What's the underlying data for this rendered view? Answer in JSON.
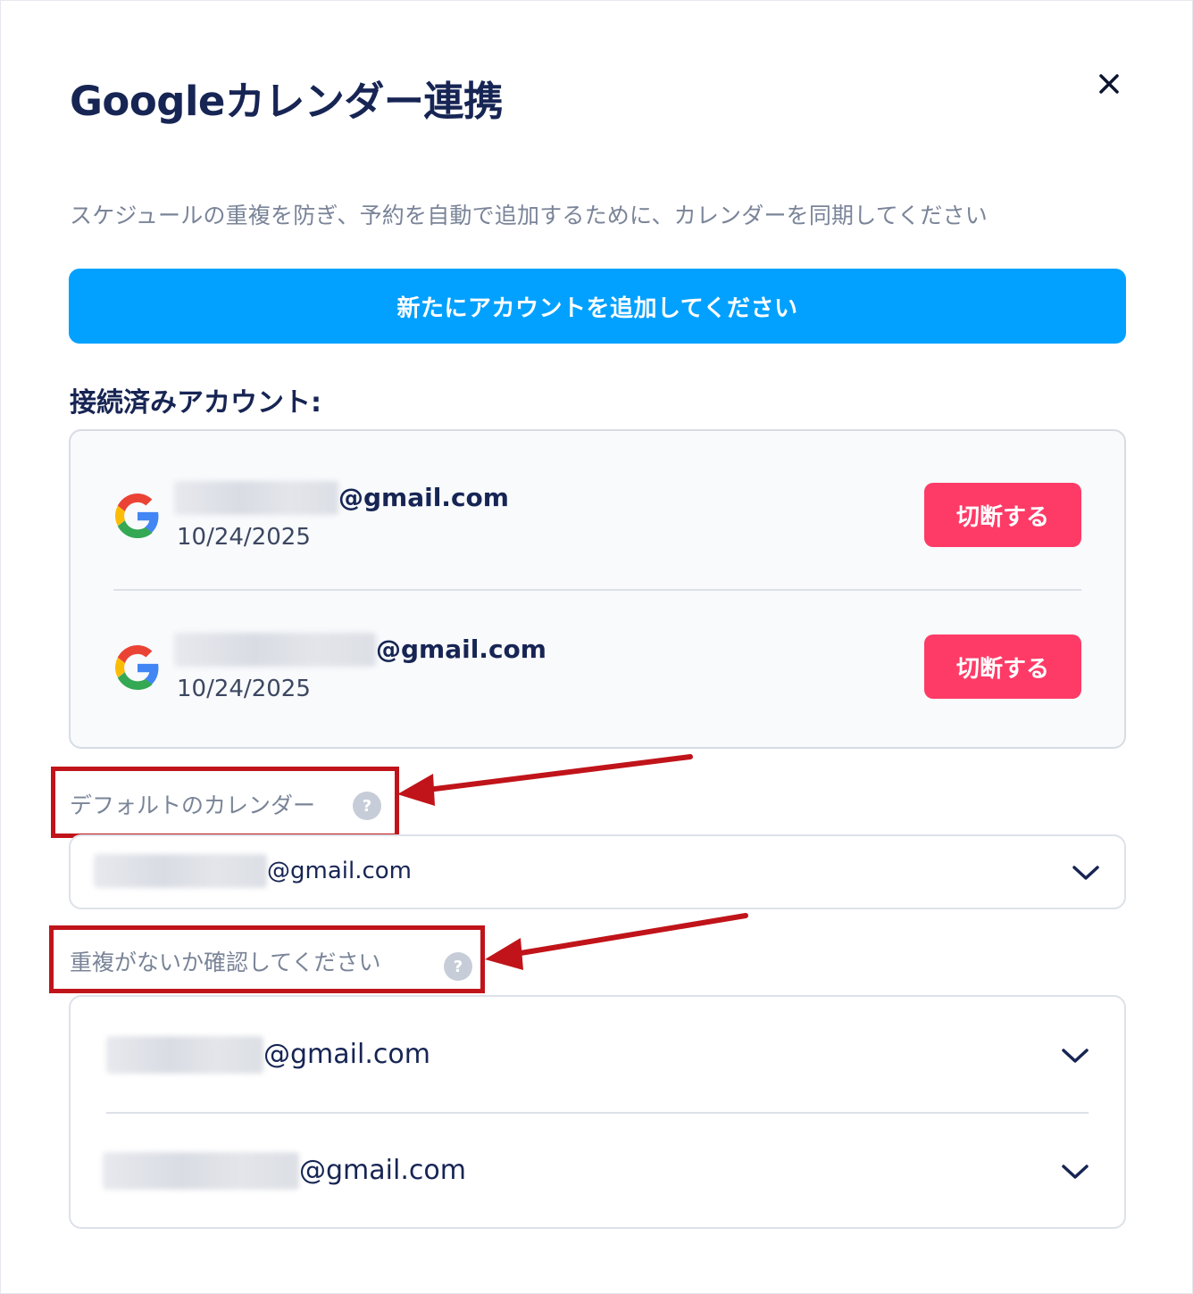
{
  "modal": {
    "title": "Googleカレンダー連携",
    "subtitle": "スケジュールの重複を防ぎ、予約を自動で追加するために、カレンダーを同期してください",
    "add_account_label": "新たにアカウントを追加してください",
    "connected_label": "接続済みアカウント:"
  },
  "accounts": [
    {
      "email_suffix": "@gmail.com",
      "date": "10/24/2025",
      "disconnect_label": "切断する"
    },
    {
      "email_suffix": "@gmail.com",
      "date": "10/24/2025",
      "disconnect_label": "切断する"
    }
  ],
  "default_calendar": {
    "label": "デフォルトのカレンダー",
    "help": "?",
    "selected_suffix": "@gmail.com"
  },
  "overlap": {
    "label": "重複がないか確認してください",
    "help": "?",
    "items": [
      {
        "email_suffix": "@gmail.com"
      },
      {
        "email_suffix": "@gmail.com"
      }
    ]
  },
  "colors": {
    "primary": "#03a1ff",
    "danger": "#fe3b67",
    "title": "#172554",
    "annotation": "#c0141a"
  },
  "icons": {
    "close": "close-icon",
    "google": "google-logo-icon",
    "chevron": "chevron-down-icon",
    "help": "help-circle-icon"
  }
}
